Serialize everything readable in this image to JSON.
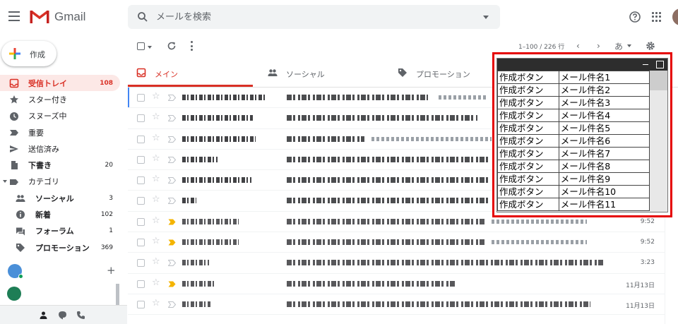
{
  "header": {
    "logo_text": "Gmail",
    "search_placeholder": "メールを検索"
  },
  "compose": {
    "label": "作成"
  },
  "nav": {
    "items": [
      {
        "label": "受信トレイ",
        "count": "108",
        "icon": "inbox-icon"
      },
      {
        "label": "スター付き",
        "count": "",
        "icon": "star-icon"
      },
      {
        "label": "スヌーズ中",
        "count": "",
        "icon": "clock-icon"
      },
      {
        "label": "重要",
        "count": "",
        "icon": "label-important-icon"
      },
      {
        "label": "送信済み",
        "count": "",
        "icon": "send-icon"
      },
      {
        "label": "下書き",
        "count": "20",
        "icon": "draft-icon"
      },
      {
        "label": "カテゴリ",
        "count": "",
        "icon": "label-icon"
      },
      {
        "label": "ソーシャル",
        "count": "3",
        "icon": "people-icon"
      },
      {
        "label": "新着",
        "count": "102",
        "icon": "info-icon"
      },
      {
        "label": "フォーラム",
        "count": "1",
        "icon": "forum-icon"
      },
      {
        "label": "プロモーション",
        "count": "369",
        "icon": "tag-icon"
      }
    ]
  },
  "toolbar": {
    "pagination": "1–100 / 226 行",
    "prev": "‹",
    "next": "›",
    "lang": "あ"
  },
  "tabs": [
    {
      "label": "メイン",
      "icon": "inbox-icon"
    },
    {
      "label": "ソーシャル",
      "icon": "people-icon"
    },
    {
      "label": "プロモーション",
      "icon": "tag-icon"
    }
  ],
  "emails": {
    "times": [
      "",
      "",
      "",
      "",
      "",
      "",
      "9:52",
      "9:52",
      "3:23",
      "11月13日",
      "11月13日",
      "11月13日"
    ]
  },
  "overlay": {
    "rows": [
      {
        "button": "作成ボタン",
        "subject": "メール件名1"
      },
      {
        "button": "作成ボタン",
        "subject": "メール件名2"
      },
      {
        "button": "作成ボタン",
        "subject": "メール件名3"
      },
      {
        "button": "作成ボタン",
        "subject": "メール件名4"
      },
      {
        "button": "作成ボタン",
        "subject": "メール件名5"
      },
      {
        "button": "作成ボタン",
        "subject": "メール件名6"
      },
      {
        "button": "作成ボタン",
        "subject": "メール件名7"
      },
      {
        "button": "作成ボタン",
        "subject": "メール件名8"
      },
      {
        "button": "作成ボタン",
        "subject": "メール件名9"
      },
      {
        "button": "作成ボタン",
        "subject": "メール件名10"
      },
      {
        "button": "作成ボタン",
        "subject": "メール件名11"
      }
    ]
  },
  "colors": {
    "accent_red": "#d93025",
    "overlay_border": "#e50000",
    "important_marker": "#f4b400"
  }
}
